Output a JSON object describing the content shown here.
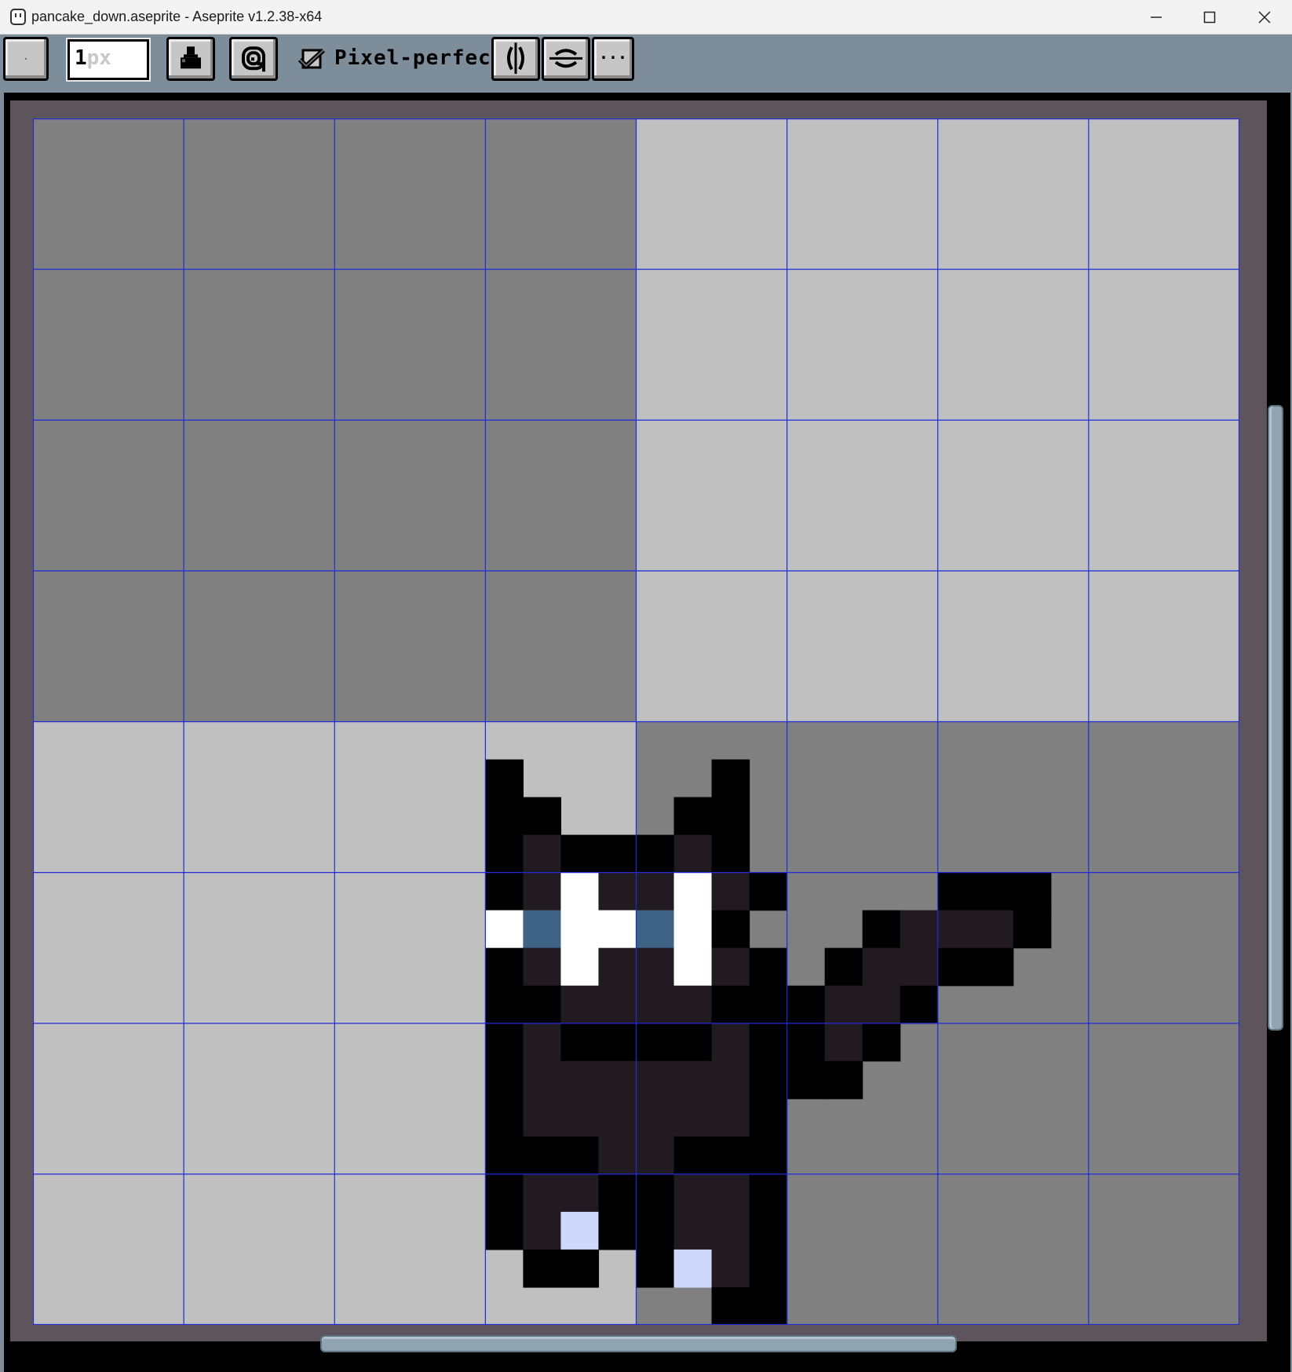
{
  "window": {
    "title": "pancake_down.aseprite - Aseprite v1.2.38-x64",
    "icon": "aseprite-icon",
    "controls": [
      "minimize-icon",
      "maximize-icon",
      "close-icon"
    ]
  },
  "toolbar": {
    "brush_type_icon": "brush-type-icon",
    "brush_size": {
      "value": "1",
      "unit": "px"
    },
    "ink_icon": "ink-bottle-icon",
    "opacity_icon": "opacity-spiral-icon",
    "pixel_perfect": {
      "label": "Pixel-perfect",
      "checked": true
    },
    "symmetry_vertical_icon": "vertical-symmetry-icon",
    "symmetry_horizontal_icon": "horizontal-symmetry-icon",
    "more_label": "..."
  },
  "canvas": {
    "checker_cells": 8,
    "checker_colors": {
      "dark": "#808080",
      "light": "#c0c0c0"
    },
    "grid_color": "#1f2bd6",
    "palette": {
      "K": "#000000",
      "D": "#221a21",
      "W": "#ffffff",
      "B": "#3f6384",
      "L": "#ced8fb"
    },
    "sprite_rows": [
      "................................",
      "................................",
      "................................",
      "................................",
      "................................",
      "................................",
      "................................",
      "................................",
      "................................",
      "................................",
      "................................",
      "................................",
      "................................",
      "................................",
      "................................",
      "................................",
      "................................",
      "............K.....K.............",
      "............KK...KK.............",
      "............KDKKKDK.............",
      "............KDWDDWDK....KKK.....",
      "............WBWWBWK...KDDDK....",
      "............KDWDDWDK.KDDKK.....",
      "............KKDDDDKKKDDK.......",
      "............KDKKKKDKKDK........",
      "............KDDDDDDKKK.........",
      "............KDDDDDDK...........",
      "............KKKDDKKK...........",
      "............KDDKKDDK...........",
      "............KDLKKDDK...........",
      ".............KK.KLDK...........",
      "..................KK............"
    ]
  }
}
